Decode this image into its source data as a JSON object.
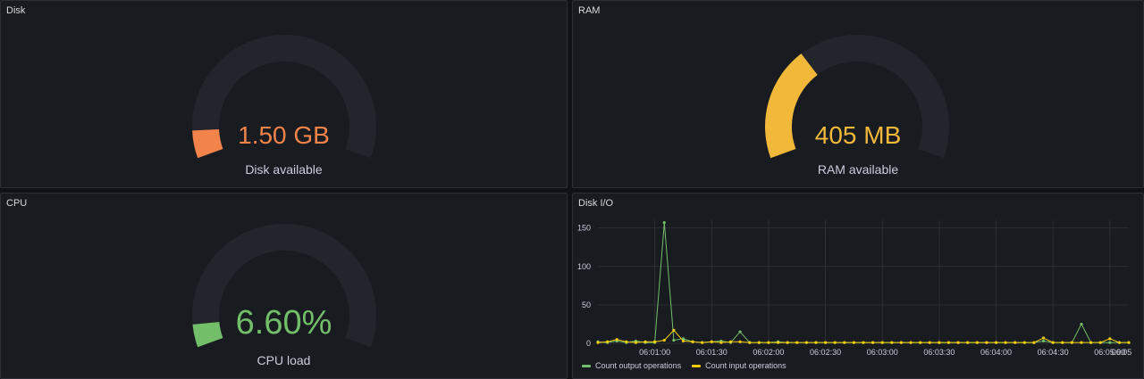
{
  "panels": {
    "disk": {
      "title": "Disk",
      "value": "1.50 GB",
      "label": "Disk available",
      "fraction": 0.08,
      "color": "#f2834a"
    },
    "ram": {
      "title": "RAM",
      "value": "405 MB",
      "label": "RAM available",
      "fraction": 0.33,
      "color": "#f2b83a"
    },
    "cpu": {
      "title": "CPU",
      "value": "6.60%",
      "label": "CPU load",
      "fraction": 0.066,
      "color": "#73bf69"
    },
    "io": {
      "title": "Disk I/O"
    }
  },
  "colors": {
    "background": "#111217",
    "panel": "#181b1f",
    "gauge_track": "#22252b",
    "grid": "#2c2f35",
    "output_series": "#73bf69",
    "input_series": "#f2cc0c"
  },
  "chart_data": {
    "type": "line",
    "title": "Disk I/O",
    "x_ticks": [
      "06:01:00",
      "06:01:30",
      "06:02:00",
      "06:02:30",
      "06:03:00",
      "06:03:30",
      "06:04:00",
      "06:04:30",
      "06:05:00",
      "06:05"
    ],
    "y_ticks": [
      "0",
      "50",
      "100",
      "150"
    ],
    "ylim": [
      0,
      160
    ],
    "x_range_seconds": [
      30,
      310
    ],
    "x": [
      30,
      35,
      40,
      45,
      50,
      55,
      60,
      65,
      70,
      75,
      80,
      85,
      90,
      95,
      100,
      105,
      110,
      115,
      120,
      125,
      130,
      135,
      140,
      145,
      150,
      155,
      160,
      165,
      170,
      175,
      180,
      185,
      190,
      195,
      200,
      205,
      210,
      215,
      220,
      225,
      230,
      235,
      240,
      245,
      250,
      255,
      260,
      265,
      270,
      275,
      280,
      285,
      290,
      295,
      300,
      305,
      310
    ],
    "series": [
      {
        "name": "Count output operations",
        "color": "#73bf69",
        "values": [
          2,
          1,
          3,
          1,
          3,
          1,
          1,
          157,
          4,
          6,
          2,
          1,
          2,
          3,
          1,
          15,
          1,
          1,
          1,
          2,
          1,
          1,
          1,
          1,
          1,
          1,
          1,
          1,
          1,
          1,
          1,
          1,
          1,
          1,
          1,
          1,
          1,
          1,
          1,
          1,
          1,
          1,
          1,
          1,
          1,
          1,
          1,
          3,
          1,
          1,
          1,
          25,
          1,
          1,
          1,
          1,
          1
        ]
      },
      {
        "name": "Count input operations",
        "color": "#f2cc0c",
        "values": [
          1,
          2,
          5,
          2,
          1,
          2,
          2,
          4,
          17,
          3,
          2,
          1,
          2,
          1,
          2,
          2,
          1,
          1,
          1,
          1,
          1,
          1,
          1,
          1,
          1,
          1,
          1,
          1,
          1,
          1,
          1,
          1,
          1,
          1,
          1,
          1,
          1,
          1,
          1,
          1,
          1,
          1,
          1,
          1,
          1,
          1,
          1,
          7,
          1,
          1,
          1,
          1,
          1,
          1,
          6,
          1,
          1
        ]
      }
    ],
    "legend_position": "bottom-left",
    "grid": true
  }
}
